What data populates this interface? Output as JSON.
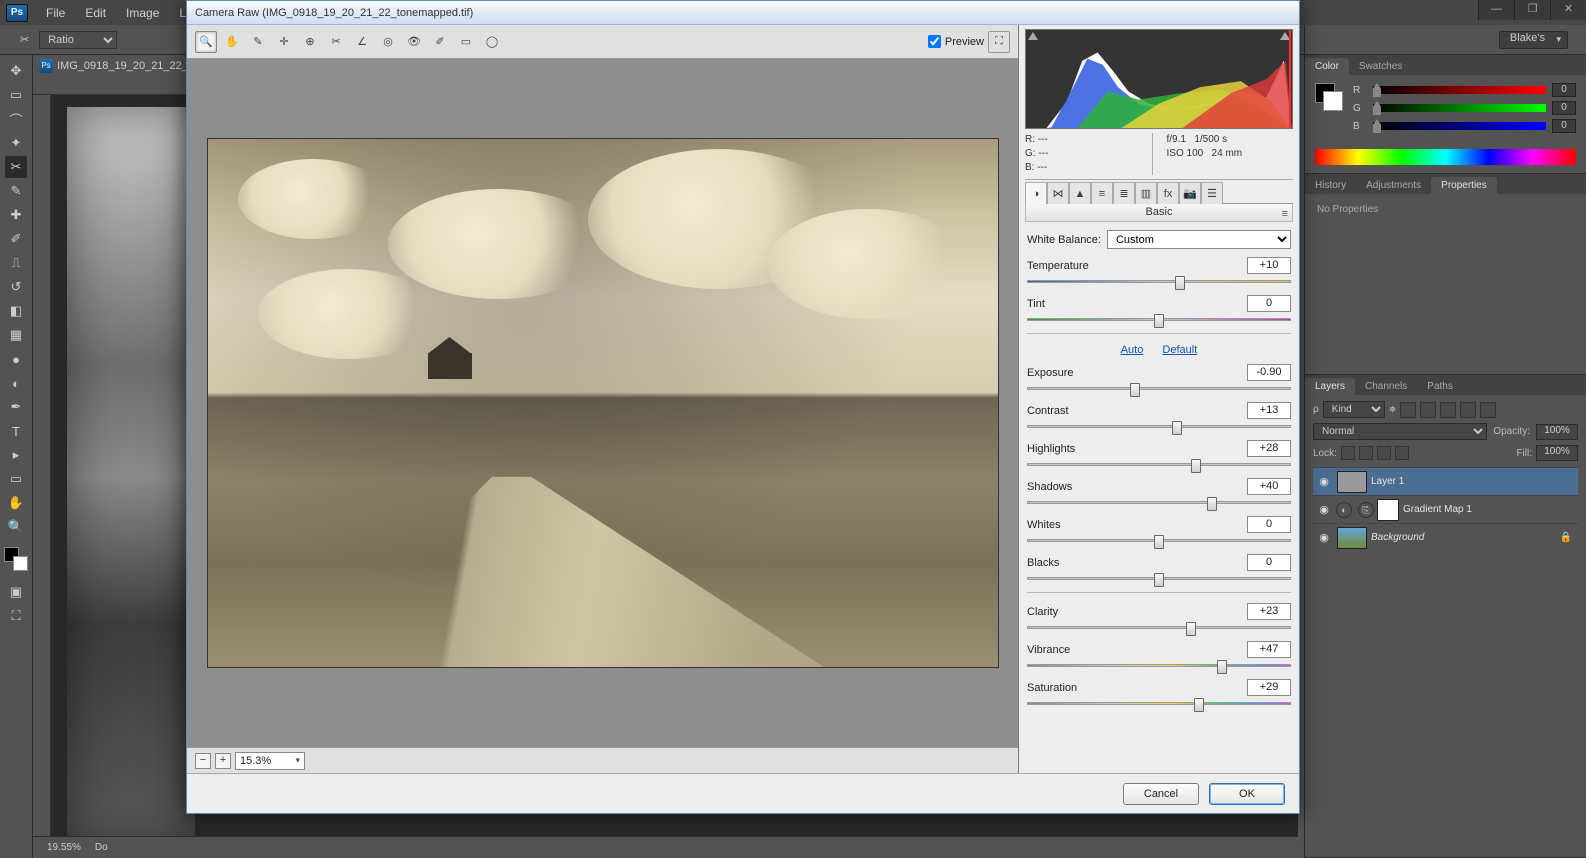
{
  "menubar": {
    "items": [
      "File",
      "Edit",
      "Image",
      "Laye"
    ]
  },
  "optionsbar": {
    "ratio_label": "Ratio"
  },
  "workspace_name": "Blake's",
  "doc_tab": {
    "name": "IMG_0918_19_20_21_22_..."
  },
  "statusbar": {
    "zoom": "19.55%",
    "doc_label": "Do"
  },
  "panels": {
    "color": {
      "tabs": [
        "Color",
        "Swatches"
      ],
      "rgb": {
        "r": "0",
        "g": "0",
        "b": "0"
      }
    },
    "history_adjust_props": {
      "tabs": [
        "History",
        "Adjustments",
        "Properties"
      ],
      "body": "No Properties"
    },
    "layers": {
      "tabs": [
        "Layers",
        "Channels",
        "Paths"
      ],
      "kind": "Kind",
      "blend_mode": "Normal",
      "opacity_label": "Opacity:",
      "opacity_val": "100%",
      "lock_label": "Lock:",
      "fill_label": "Fill:",
      "fill_val": "100%",
      "items": [
        {
          "name": "Layer 1"
        },
        {
          "name": "Gradient Map 1"
        },
        {
          "name": "Background"
        }
      ]
    }
  },
  "acr": {
    "title": "Camera Raw (IMG_0918_19_20_21_22_tonemapped.tif)",
    "preview_label": "Preview",
    "zoom": "15.3%",
    "readout": {
      "r": "R:   ---",
      "g": "G:   ---",
      "b": "B:   ---",
      "aperture": "f/9.1",
      "shutter": "1/500 s",
      "iso": "ISO 100",
      "focal": "24 mm"
    },
    "panel_title": "Basic",
    "white_balance_label": "White Balance:",
    "white_balance_value": "Custom",
    "links": {
      "auto": "Auto",
      "default": "Default"
    },
    "sliders": {
      "temperature": {
        "label": "Temperature",
        "value": "+10",
        "pos": 58
      },
      "tint": {
        "label": "Tint",
        "value": "0",
        "pos": 50
      },
      "exposure": {
        "label": "Exposure",
        "value": "-0.90",
        "pos": 41
      },
      "contrast": {
        "label": "Contrast",
        "value": "+13",
        "pos": 57
      },
      "highlights": {
        "label": "Highlights",
        "value": "+28",
        "pos": 64
      },
      "shadows": {
        "label": "Shadows",
        "value": "+40",
        "pos": 70
      },
      "whites": {
        "label": "Whites",
        "value": "0",
        "pos": 50
      },
      "blacks": {
        "label": "Blacks",
        "value": "0",
        "pos": 50
      },
      "clarity": {
        "label": "Clarity",
        "value": "+23",
        "pos": 62
      },
      "vibrance": {
        "label": "Vibrance",
        "value": "+47",
        "pos": 74
      },
      "saturation": {
        "label": "Saturation",
        "value": "+29",
        "pos": 65
      }
    },
    "buttons": {
      "cancel": "Cancel",
      "ok": "OK"
    }
  }
}
